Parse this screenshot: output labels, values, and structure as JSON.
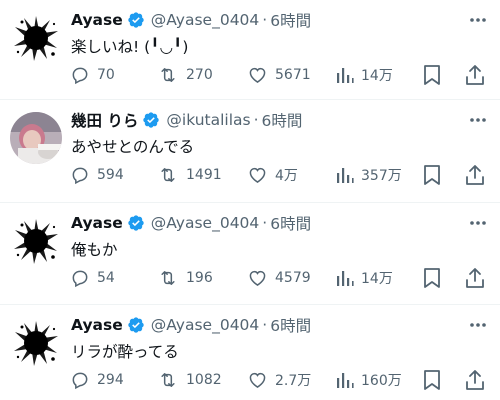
{
  "timeline": {
    "tweets": [
      {
        "display_name": "Ayase",
        "handle": "@Ayase_0404",
        "separator": "·",
        "time": "6時間",
        "text": "楽しいね! (╹◡╹)",
        "avatar_icon": "ink-splash-avatar",
        "replies": "70",
        "retweets": "270",
        "likes": "5671",
        "views": "14万"
      },
      {
        "display_name": "幾田 りら",
        "handle": "@ikutalilas",
        "separator": "·",
        "time": "6時間",
        "text": "あやせとのんでる",
        "avatar_icon": "photo-avatar",
        "replies": "594",
        "retweets": "1491",
        "likes": "4万",
        "views": "357万"
      },
      {
        "display_name": "Ayase",
        "handle": "@Ayase_0404",
        "separator": "·",
        "time": "6時間",
        "text": "俺もか",
        "avatar_icon": "ink-splash-avatar",
        "replies": "54",
        "retweets": "196",
        "likes": "4579",
        "views": "14万"
      },
      {
        "display_name": "Ayase",
        "handle": "@Ayase_0404",
        "separator": "·",
        "time": "6時間",
        "text": "リラが酔ってる",
        "avatar_icon": "ink-splash-avatar",
        "replies": "294",
        "retweets": "1082",
        "likes": "2.7万",
        "views": "160万"
      }
    ]
  },
  "colors": {
    "verified": "#1d9bf0",
    "secondary_text": "#536471",
    "primary_text": "#0f1419",
    "divider": "#eff3f4"
  }
}
